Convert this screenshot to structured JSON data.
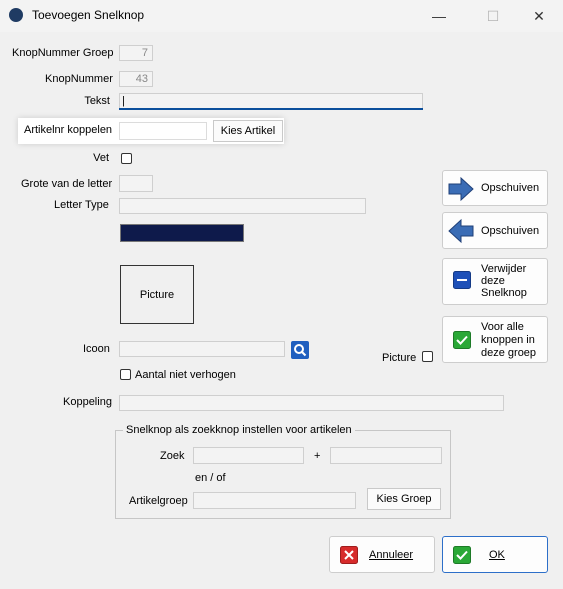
{
  "window": {
    "title": "Toevoegen Snelknop",
    "minimize": "—",
    "maximize": "☐",
    "close": "✕"
  },
  "form": {
    "knop_nummer_groep": {
      "label": "KnopNummer Groep",
      "value": "7"
    },
    "knop_nummer": {
      "label": "KnopNummer",
      "value": "43"
    },
    "tekst": {
      "label": "Tekst",
      "value": "|"
    },
    "artikelnr": {
      "label": "Artikelnr koppelen",
      "value": "",
      "button": "Kies Artikel"
    },
    "vet": {
      "label": "Vet",
      "checked": false
    },
    "grote_letter": {
      "label": "Grote van de letter",
      "value": ""
    },
    "letter_type": {
      "label": "Letter Type",
      "value": ""
    },
    "color_swatch": "#0e1a4b",
    "picture_placeholder": "Picture",
    "icoon": {
      "label": "Icoon",
      "value": "",
      "search_icon": "search-icon"
    },
    "picture_checkbox": {
      "label": "Picture",
      "checked": false
    },
    "aantal_niet_verhogen": {
      "label": "Aantal niet verhogen",
      "checked": false
    },
    "koppeling": {
      "label": "Koppeling",
      "value": ""
    },
    "zoek_group": {
      "title": "Snelknop als zoekknop instellen voor artikelen",
      "zoek_label": "Zoek",
      "plus": "+",
      "en_of": "en / of",
      "artikelgroep_label": "Artikelgroep",
      "kies_groep": "Kies Groep"
    }
  },
  "side_buttons": {
    "shift_right": {
      "label": "Opschuiven",
      "icon": "arrow-right-icon"
    },
    "shift_left": {
      "label": "Opschuiven",
      "icon": "arrow-left-icon"
    },
    "delete": {
      "label_lines": [
        "Verwijder",
        "deze",
        "Snelknop"
      ],
      "icon": "minus-icon"
    },
    "for_all": {
      "label_lines": [
        "Voor alle",
        "knoppen in",
        "deze groep"
      ],
      "icon": "check-icon"
    }
  },
  "footer": {
    "cancel": {
      "label": "Annuleer",
      "icon": "x-icon"
    },
    "ok": {
      "label": "OK",
      "icon": "check-icon"
    }
  },
  "colors": {
    "accent": "#0b4f9c",
    "ok_border": "#2d6fc9",
    "arrow": "#3a6cb5",
    "red": "#d72b2b",
    "green": "#2aa836"
  }
}
